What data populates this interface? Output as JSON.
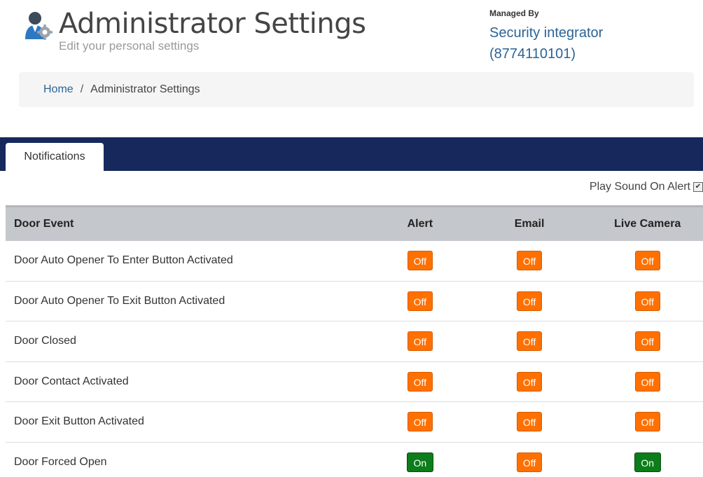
{
  "header": {
    "title": "Administrator Settings",
    "subtitle": "Edit your personal settings",
    "managed_by": {
      "label": "Managed By",
      "name": "Security integrator",
      "phone": "(8774110101)"
    }
  },
  "breadcrumb": {
    "home": "Home",
    "separator": "/",
    "current": "Administrator Settings"
  },
  "tabs": [
    {
      "label": "Notifications",
      "active": true
    }
  ],
  "play_sound": {
    "label": "Play Sound On Alert",
    "checked": true
  },
  "table": {
    "columns": [
      "Door Event",
      "Alert",
      "Email",
      "Live Camera"
    ],
    "rows": [
      {
        "event": "Door Auto Opener To Enter Button Activated",
        "alert": "Off",
        "email": "Off",
        "camera": "Off"
      },
      {
        "event": "Door Auto Opener To Exit Button Activated",
        "alert": "Off",
        "email": "Off",
        "camera": "Off"
      },
      {
        "event": "Door Closed",
        "alert": "Off",
        "email": "Off",
        "camera": "Off"
      },
      {
        "event": "Door Contact Activated",
        "alert": "Off",
        "email": "Off",
        "camera": "Off"
      },
      {
        "event": "Door Exit Button Activated",
        "alert": "Off",
        "email": "Off",
        "camera": "Off"
      },
      {
        "event": "Door Forced Open",
        "alert": "On",
        "email": "Off",
        "camera": "On"
      }
    ]
  },
  "colors": {
    "tab_bar": "#17295c",
    "off_button": "#ff7000",
    "on_button": "#0b7d1a",
    "link": "#2a6496",
    "table_header": "#c4c7cb"
  },
  "icons": {
    "admin": "admin-user-gear-icon",
    "checkbox": "checkbox-checked-icon"
  }
}
